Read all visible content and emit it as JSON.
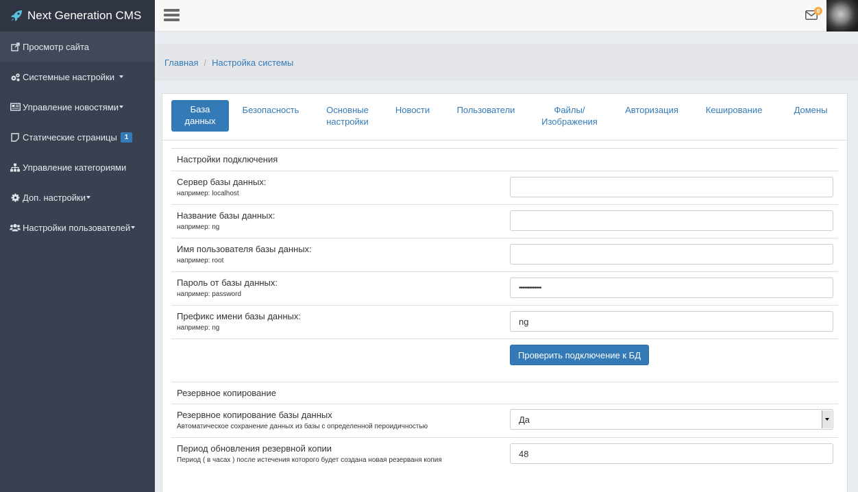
{
  "brand": {
    "title": "Next Generation CMS"
  },
  "sidebar": {
    "items": [
      {
        "label": "Просмотр сайта",
        "icon": "external-link-icon"
      },
      {
        "label": "Системные настройки",
        "icon": "cogs-icon"
      },
      {
        "label": "Управление новостями",
        "icon": "newspaper-icon"
      },
      {
        "label": "Статические страницы",
        "icon": "file-icon",
        "badge": "1"
      },
      {
        "label": "Управление категориями",
        "icon": "sitemap-icon"
      },
      {
        "label": "Доп. настройки",
        "icon": "cog-icon"
      },
      {
        "label": "Настройки пользователей",
        "icon": "users-icon"
      }
    ]
  },
  "topbar": {
    "mail_count": "0"
  },
  "breadcrumb": {
    "home": "Главная",
    "current": "Настройка системы"
  },
  "tabs": [
    {
      "label": "База данных"
    },
    {
      "label": "Безопасность"
    },
    {
      "label": "Основные настройки"
    },
    {
      "label": "Новости"
    },
    {
      "label": "Пользователи"
    },
    {
      "label": "Файлы/ Изображения"
    },
    {
      "label": "Авторизация"
    },
    {
      "label": "Кеширование"
    },
    {
      "label": "Домены"
    }
  ],
  "connection": {
    "title": "Настройки подключения",
    "fields": [
      {
        "label": "Сервер базы данных:",
        "hint": "например: localhost",
        "value": ""
      },
      {
        "label": "Название базы данных:",
        "hint": "например: ng",
        "value": ""
      },
      {
        "label": "Имя пользователя базы данных:",
        "hint": "например: root",
        "value": ""
      },
      {
        "label": "Пароль от базы данных:",
        "hint": "например: password",
        "value": "•••••••••••••"
      },
      {
        "label": "Префикс имени базы данных:",
        "hint": "например: ng",
        "value": "ng"
      }
    ],
    "check_button": "Проверить подключение к БД"
  },
  "backup": {
    "title": "Резервное копирование",
    "enabled_label": "Резервное копирование базы данных",
    "enabled_hint": "Автоматическое сохранение данных из базы с определенной пероидичностью",
    "enabled_value": "Да",
    "period_label": "Период обновления резервной копии",
    "period_hint": "Период ( в часах ) после истечения которого будет создана новая резерваня копия",
    "period_value": "48"
  },
  "colors": {
    "sidebar": "#394150",
    "accent": "#337ab7",
    "warning": "#f0ad4e"
  }
}
